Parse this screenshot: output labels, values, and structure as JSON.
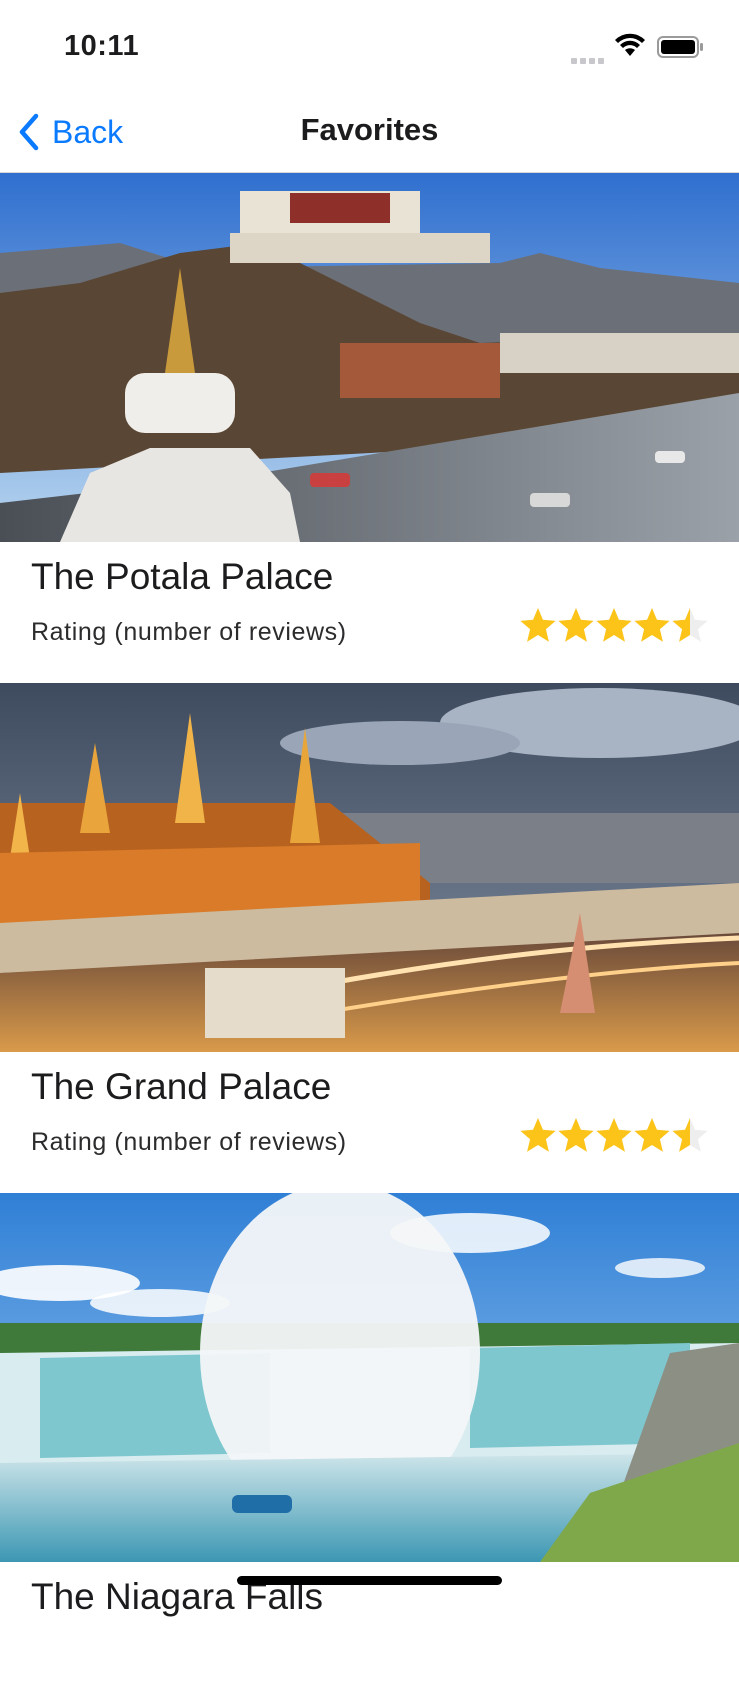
{
  "status_bar": {
    "time": "10:11",
    "icons": [
      "cellular-signal-icon",
      "wifi-icon",
      "battery-icon"
    ]
  },
  "nav": {
    "back_label": "Back",
    "back_icon": "chevron-left-icon",
    "title": "Favorites"
  },
  "favorites": [
    {
      "title": "The Potala Palace",
      "rating_text": "Rating (number of reviews)",
      "rating": 4.5,
      "rating_max": 5,
      "image": "potala-palace-photo"
    },
    {
      "title": "The Grand Palace",
      "rating_text": "Rating (number of reviews)",
      "rating": 4.5,
      "rating_max": 5,
      "image": "grand-palace-photo"
    },
    {
      "title": "The Niagara Falls",
      "image": "niagara-falls-photo"
    }
  ],
  "colors": {
    "accent": "#0a7aff",
    "star_filled": "#fcc419",
    "star_empty": "#eeeeee"
  }
}
